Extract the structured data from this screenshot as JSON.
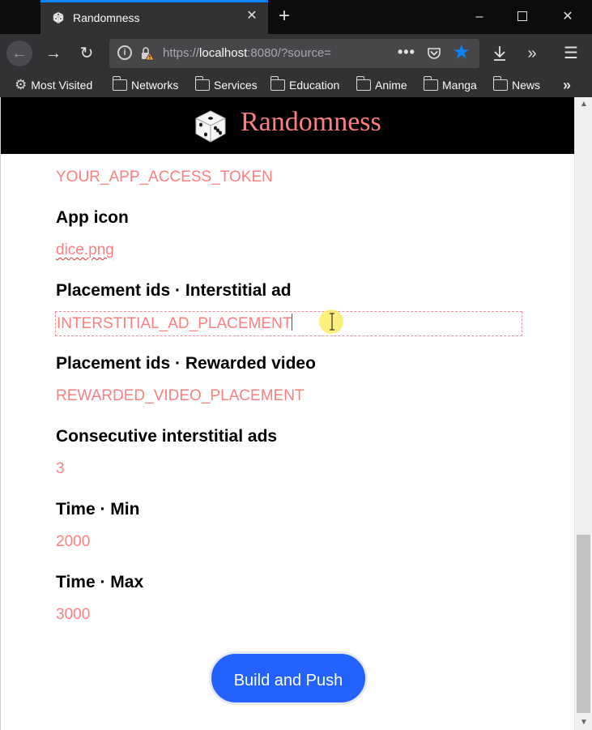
{
  "browser": {
    "tab_title": "Randomness",
    "tab_close": "✕",
    "new_tab": "+",
    "url_scheme": "https://",
    "url_host": "localhost",
    "url_rest": ":8080/?source=",
    "url_more": "•••",
    "minimize": "–",
    "close": "✕"
  },
  "bookmarks": [
    {
      "label": "Most Visited",
      "icon": "gear-icon"
    },
    {
      "label": "Networks",
      "icon": "folder-icon"
    },
    {
      "label": "Services",
      "icon": "folder-icon"
    },
    {
      "label": "Education",
      "icon": "folder-icon"
    },
    {
      "label": "Anime",
      "icon": "folder-icon"
    },
    {
      "label": "Manga",
      "icon": "folder-icon"
    },
    {
      "label": "News",
      "icon": "folder-icon"
    }
  ],
  "page": {
    "site_title": "Randomness",
    "access_token_value": "YOUR_APP_ACCESS_TOKEN",
    "fields": [
      {
        "label": "App icon",
        "value": "dice.png"
      },
      {
        "label": "Placement ids · Interstitial ad",
        "value": "INTERSTITIAL_AD_PLACEMENT"
      },
      {
        "label": "Placement ids · Rewarded video",
        "value": "REWARDED_VIDEO_PLACEMENT"
      },
      {
        "label": "Consecutive interstitial ads",
        "value": "3"
      },
      {
        "label": "Time · Min",
        "value": "2000"
      },
      {
        "label": "Time · Max",
        "value": "3000"
      }
    ],
    "build_button": "Build and Push"
  },
  "colors": {
    "accent": "#ff7f80",
    "button": "#2362ff",
    "tab_highlight": "#0a84ff"
  }
}
